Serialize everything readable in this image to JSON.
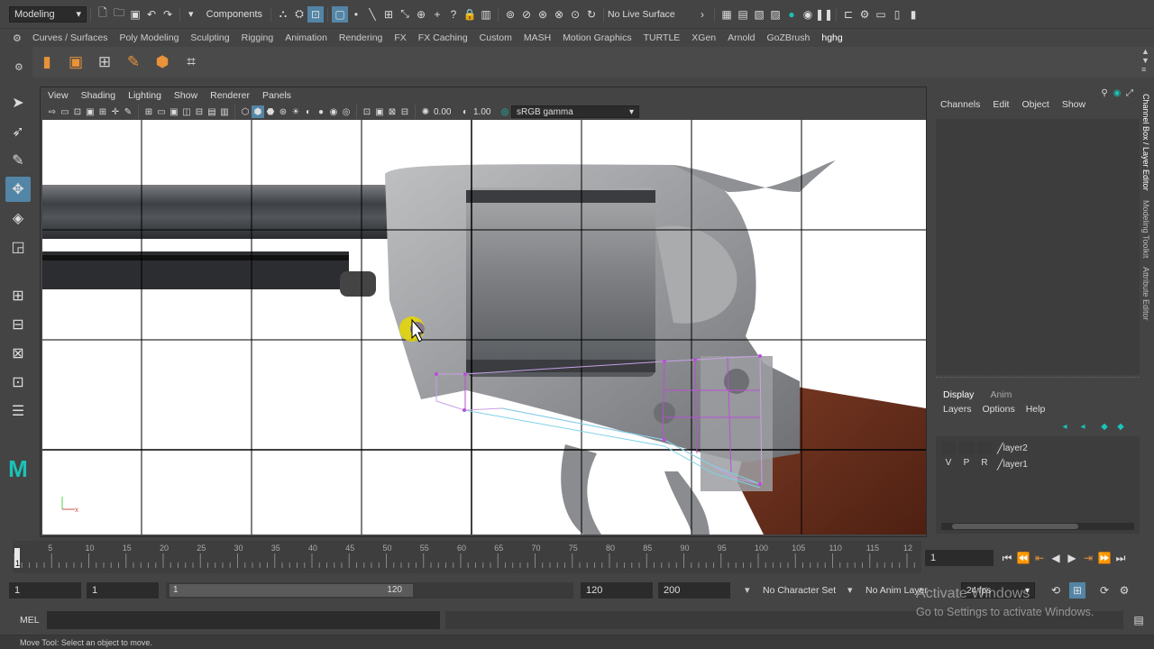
{
  "topbar": {
    "mode_menu": "Modeling",
    "selection_mode": "Components",
    "live_surface": "No Live Surface"
  },
  "shelf_tabs": [
    "Curves / Surfaces",
    "Poly Modeling",
    "Sculpting",
    "Rigging",
    "Animation",
    "Rendering",
    "FX",
    "FX Caching",
    "Custom",
    "MASH",
    "Motion Graphics",
    "TURTLE",
    "XGen",
    "Arnold",
    "GoZBrush",
    "hghg"
  ],
  "panel": {
    "menus": [
      "View",
      "Shading",
      "Lighting",
      "Show",
      "Renderer",
      "Panels"
    ],
    "exposure": "0.00",
    "gamma": "1.00",
    "color_space": "sRGB gamma"
  },
  "channel_box": {
    "menus": [
      "Channels",
      "Edit",
      "Object",
      "Show"
    ]
  },
  "layer_editor": {
    "tabs": [
      "Display",
      "Anim"
    ],
    "menus": [
      "Layers",
      "Options",
      "Help"
    ],
    "layers": [
      {
        "v": "",
        "p": "",
        "r": "",
        "name": "layer2"
      },
      {
        "v": "V",
        "p": "P",
        "r": "R",
        "name": "layer1"
      }
    ]
  },
  "side_tabs": [
    "Channel Box / Layer Editor",
    "Modeling Toolkit",
    "Attribute Editor"
  ],
  "timeline": {
    "ticks": [
      "5",
      "10",
      "15",
      "20",
      "25",
      "30",
      "35",
      "40",
      "45",
      "50",
      "55",
      "60",
      "65",
      "70",
      "75",
      "80",
      "85",
      "90",
      "95",
      "100",
      "105",
      "110",
      "115",
      "12"
    ],
    "current_frame_marker": "1",
    "current_frame_field": "1"
  },
  "range": {
    "start": "1",
    "playback_start": "1",
    "slider_start": "1",
    "slider_end": "120",
    "playback_end": "120",
    "end": "200",
    "character_set": "No Character Set",
    "anim_layer": "No Anim Layer",
    "fps": "24 fps"
  },
  "mel": {
    "label": "MEL"
  },
  "watermark": {
    "title": "Activate Windows",
    "subtitle": "Go to Settings to activate Windows."
  },
  "help_line": "Move Tool: Select an object to move.",
  "colors": {
    "accent": "#5285a6",
    "maya_logo": "#19c3b7",
    "wireframe": "#b84fd6"
  }
}
